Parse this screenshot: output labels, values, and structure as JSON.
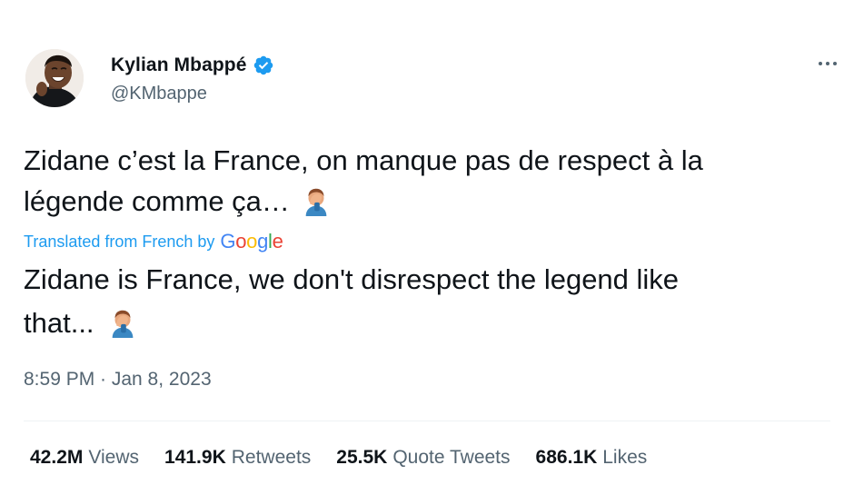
{
  "author": {
    "display_name": "Kylian Mbappé",
    "handle": "@KMbappe",
    "verified": true,
    "avatar_icon": "profile-photo"
  },
  "tweet": {
    "original_line1": "Zidane c’est la France, on manque pas de respect à la",
    "original_line2": "légende comme ça…",
    "translated_label": "Translated from French by",
    "translated_provider": "Google",
    "translation_line1": "Zidane is France, we don't disrespect the legend like",
    "translation_line2": "that...",
    "emoji": "man-facepalming-emoji",
    "timestamp": "8:59 PM · Jan 8, 2023"
  },
  "stats": {
    "views_count": "42.2M",
    "views_label": "Views",
    "retweets_count": "141.9K",
    "retweets_label": "Retweets",
    "quotes_count": "25.5K",
    "quotes_label": "Quote Tweets",
    "likes_count": "686.1K",
    "likes_label": "Likes"
  },
  "colors": {
    "link_blue": "#1d9bf0",
    "secondary_text": "#536471",
    "primary_text": "#0f1419",
    "google_blue": "#4285F4",
    "google_red": "#EA4335",
    "google_yellow": "#FBBC05",
    "google_green": "#34A853"
  }
}
